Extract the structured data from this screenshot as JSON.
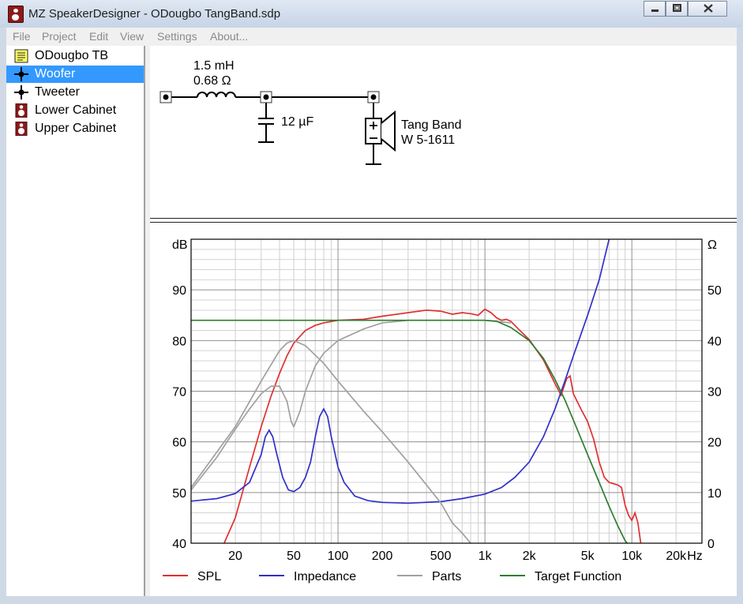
{
  "window": {
    "title": "MZ SpeakerDesigner - ODougbo TangBand.sdp"
  },
  "menu": [
    "File",
    "Project",
    "Edit",
    "View",
    "Settings",
    "About..."
  ],
  "tree": [
    {
      "label": "ODougbo TB",
      "icon": "note-icon"
    },
    {
      "label": "Woofer",
      "icon": "crossover-node-icon",
      "selected": true
    },
    {
      "label": "Tweeter",
      "icon": "crossover-node-icon"
    },
    {
      "label": "Lower Cabinet",
      "icon": "speaker-cabinet-icon"
    },
    {
      "label": "Upper Cabinet",
      "icon": "speaker-cabinet-icon"
    }
  ],
  "schematic": {
    "inductor": {
      "value": "1.5 mH",
      "resistance": "0.68 Ω"
    },
    "capacitor": {
      "value": "12 µF"
    },
    "driver": {
      "line1": "Tang Band",
      "line2": "W 5-1611"
    }
  },
  "chart_data": {
    "type": "line",
    "x_scale": "log",
    "xlim": [
      10,
      30000
    ],
    "y_left": {
      "label": "dB",
      "lim": [
        40,
        100
      ],
      "ticks": [
        40,
        50,
        60,
        70,
        80,
        90
      ]
    },
    "y_right": {
      "label": "Ω",
      "lim": [
        0,
        60
      ],
      "ticks": [
        0,
        10,
        20,
        30,
        40,
        50
      ]
    },
    "x_ticks": [
      {
        "v": 20,
        "t": "20"
      },
      {
        "v": 50,
        "t": "50"
      },
      {
        "v": 100,
        "t": "100"
      },
      {
        "v": 200,
        "t": "200"
      },
      {
        "v": 500,
        "t": "500"
      },
      {
        "v": 1000,
        "t": "1k"
      },
      {
        "v": 2000,
        "t": "2k"
      },
      {
        "v": 5000,
        "t": "5k"
      },
      {
        "v": 10000,
        "t": "10k"
      },
      {
        "v": 20000,
        "t": "20k"
      }
    ],
    "x_unit": "Hz",
    "grid": true,
    "legend_position": "bottom",
    "series": [
      {
        "name": "SPL",
        "color": "#e03030",
        "axis": "left",
        "points": [
          [
            16.8,
            40
          ],
          [
            20,
            45
          ],
          [
            25,
            55
          ],
          [
            30,
            63
          ],
          [
            35,
            69
          ],
          [
            40,
            73.5
          ],
          [
            45,
            77
          ],
          [
            50,
            79.5
          ],
          [
            60,
            82
          ],
          [
            70,
            83
          ],
          [
            80,
            83.5
          ],
          [
            100,
            84
          ],
          [
            150,
            84.2
          ],
          [
            200,
            84.8
          ],
          [
            300,
            85.5
          ],
          [
            400,
            86
          ],
          [
            500,
            85.8
          ],
          [
            600,
            85.2
          ],
          [
            700,
            85.5
          ],
          [
            800,
            85.3
          ],
          [
            900,
            85
          ],
          [
            1000,
            86.2
          ],
          [
            1100,
            85.5
          ],
          [
            1200,
            84.5
          ],
          [
            1300,
            84
          ],
          [
            1400,
            84.2
          ],
          [
            1500,
            83.8
          ],
          [
            1700,
            82.2
          ],
          [
            2000,
            80.2
          ],
          [
            2500,
            76.2
          ],
          [
            3000,
            71.5
          ],
          [
            3300,
            69.2
          ],
          [
            3600,
            72.5
          ],
          [
            3800,
            73
          ],
          [
            4000,
            69.5
          ],
          [
            4500,
            66.5
          ],
          [
            5000,
            64
          ],
          [
            5500,
            60.5
          ],
          [
            6000,
            56
          ],
          [
            6500,
            53
          ],
          [
            7000,
            52
          ],
          [
            8000,
            51.5
          ],
          [
            8500,
            51
          ],
          [
            9000,
            47.5
          ],
          [
            9500,
            45.5
          ],
          [
            10000,
            44.5
          ],
          [
            10500,
            46
          ],
          [
            11000,
            44
          ],
          [
            11500,
            40
          ]
        ]
      },
      {
        "name": "Impedance",
        "color": "#3030c8",
        "axis": "right",
        "points": [
          [
            10,
            8.3
          ],
          [
            15,
            8.8
          ],
          [
            20,
            9.8
          ],
          [
            25,
            12
          ],
          [
            30,
            17.5
          ],
          [
            32,
            21
          ],
          [
            34,
            22.3
          ],
          [
            36,
            21
          ],
          [
            38,
            18
          ],
          [
            42,
            13
          ],
          [
            46,
            10.5
          ],
          [
            50,
            10.2
          ],
          [
            55,
            11
          ],
          [
            60,
            13
          ],
          [
            65,
            16
          ],
          [
            70,
            21
          ],
          [
            75,
            25
          ],
          [
            80,
            26.5
          ],
          [
            85,
            25
          ],
          [
            90,
            21
          ],
          [
            100,
            15
          ],
          [
            110,
            12
          ],
          [
            130,
            9.3
          ],
          [
            160,
            8.4
          ],
          [
            200,
            8.05
          ],
          [
            300,
            7.9
          ],
          [
            500,
            8.2
          ],
          [
            700,
            8.8
          ],
          [
            1000,
            9.7
          ],
          [
            1300,
            11
          ],
          [
            1600,
            13
          ],
          [
            2000,
            16
          ],
          [
            2500,
            21
          ],
          [
            3000,
            26.5
          ],
          [
            3500,
            32
          ],
          [
            4000,
            37
          ],
          [
            5000,
            45
          ],
          [
            6000,
            52
          ],
          [
            7000,
            60
          ],
          [
            7200,
            62
          ]
        ]
      },
      {
        "name": "Parts",
        "color": "#a0a0a0",
        "axis": "left",
        "points": [
          [
            10,
            50.5
          ],
          [
            15,
            57
          ],
          [
            20,
            62.5
          ],
          [
            25,
            66.5
          ],
          [
            30,
            69.5
          ],
          [
            35,
            71
          ],
          [
            40,
            71
          ],
          [
            45,
            68
          ],
          [
            48,
            64
          ],
          [
            50,
            63
          ],
          [
            55,
            66
          ],
          [
            60,
            70
          ],
          [
            70,
            75
          ],
          [
            80,
            77.5
          ],
          [
            100,
            80
          ],
          [
            150,
            82.3
          ],
          [
            200,
            83.5
          ],
          [
            300,
            84
          ],
          [
            500,
            84
          ],
          [
            1000,
            84
          ],
          [
            1500,
            83.5
          ]
        ]
      },
      {
        "name": "Parts",
        "color": "#a0a0a0",
        "axis": "left",
        "points": [
          [
            10,
            51
          ],
          [
            20,
            63
          ],
          [
            30,
            72
          ],
          [
            40,
            78
          ],
          [
            45,
            79.5
          ],
          [
            50,
            80
          ],
          [
            60,
            79
          ],
          [
            80,
            75.5
          ],
          [
            100,
            72
          ],
          [
            150,
            66
          ],
          [
            200,
            62
          ],
          [
            300,
            56
          ],
          [
            400,
            51.5
          ],
          [
            500,
            48
          ],
          [
            600,
            44
          ],
          [
            700,
            42
          ],
          [
            800,
            40
          ]
        ]
      },
      {
        "name": "Target Function",
        "color": "#2e7d32",
        "axis": "left",
        "points": [
          [
            10,
            84
          ],
          [
            100,
            84
          ],
          [
            500,
            84
          ],
          [
            1000,
            84
          ],
          [
            1200,
            83.8
          ],
          [
            1500,
            82.6
          ],
          [
            2000,
            80
          ],
          [
            2500,
            76.5
          ],
          [
            3000,
            72.3
          ],
          [
            3500,
            68.3
          ],
          [
            4000,
            64.3
          ],
          [
            5000,
            57.5
          ],
          [
            6000,
            52
          ],
          [
            7000,
            47.3
          ],
          [
            8000,
            43.5
          ],
          [
            9000,
            40.5
          ],
          [
            9300,
            40
          ]
        ]
      }
    ],
    "legend": [
      {
        "name": "SPL",
        "color": "#e03030"
      },
      {
        "name": "Impedance",
        "color": "#3030c8"
      },
      {
        "name": "Parts",
        "color": "#a0a0a0"
      },
      {
        "name": "Target Function",
        "color": "#2e7d32"
      }
    ]
  }
}
